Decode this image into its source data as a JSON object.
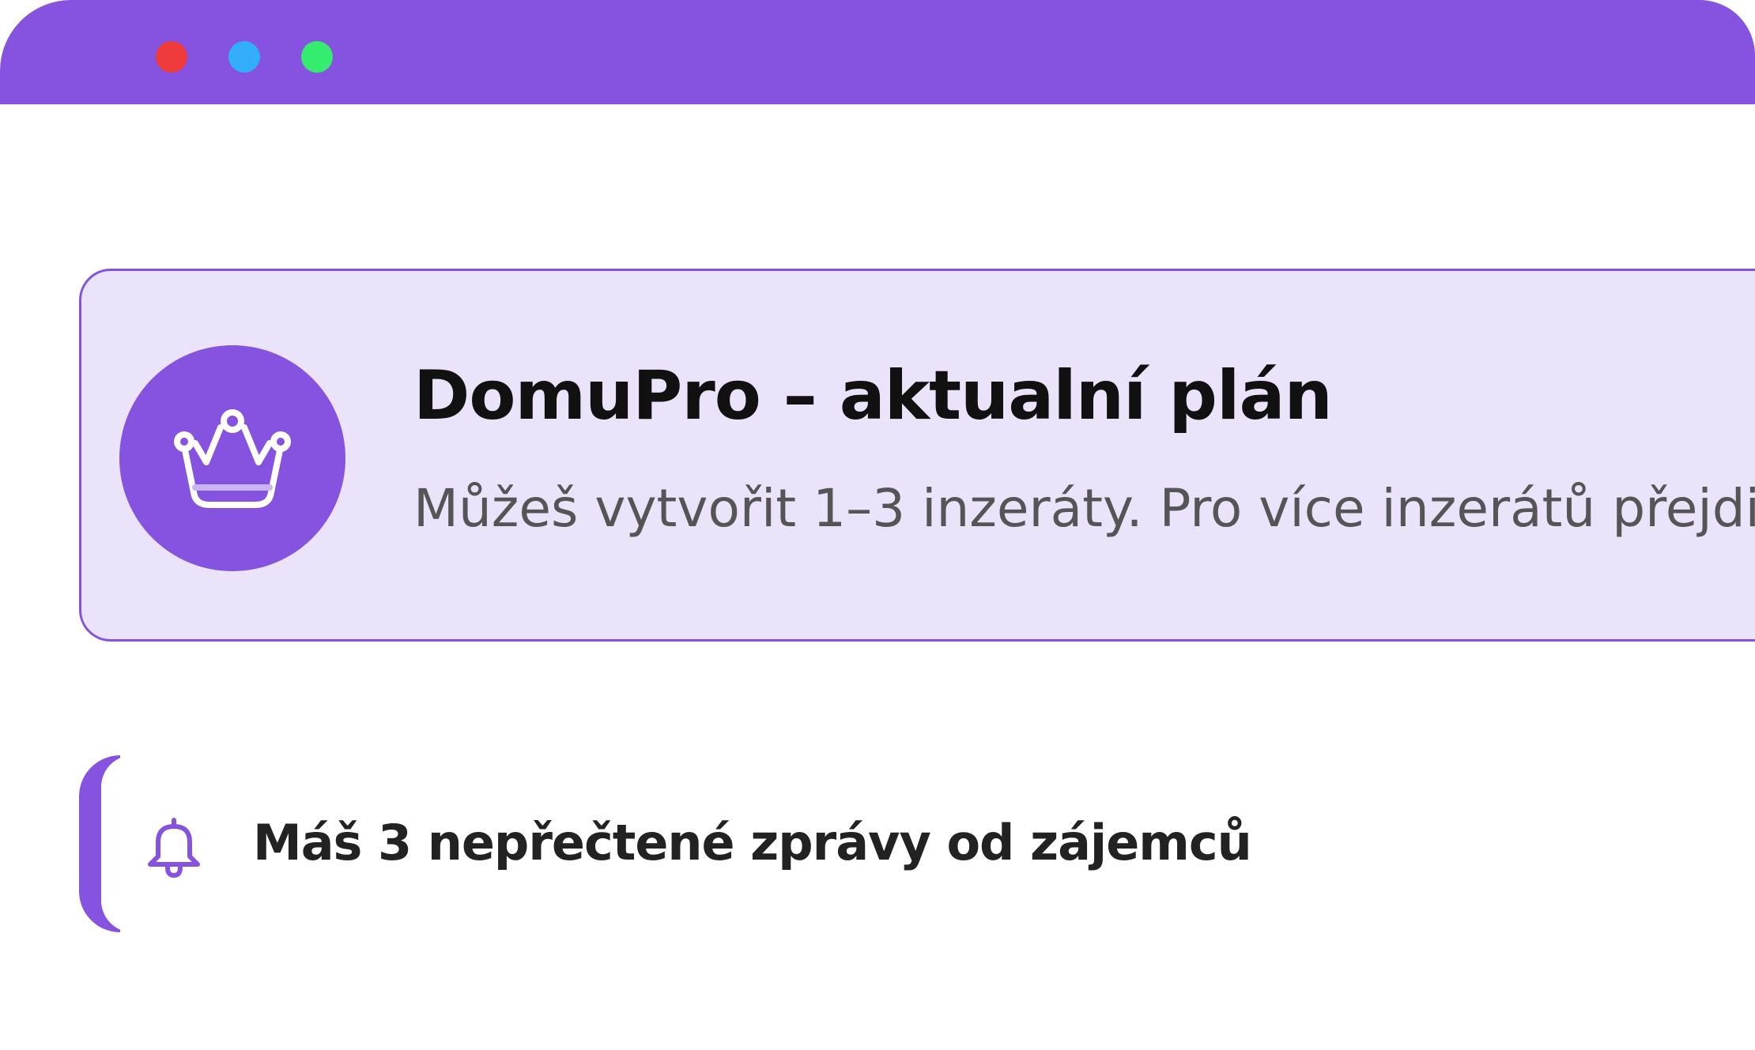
{
  "window": {
    "controls": [
      "close",
      "minimize",
      "maximize"
    ],
    "colors": {
      "titlebar": "#8652E0",
      "close": "#EF3B3B",
      "minimize": "#32ADF8",
      "maximize": "#34ED6E"
    }
  },
  "plan_card": {
    "icon": "crown-icon",
    "title": "DomuPro – aktualní plán",
    "description": "Můžeš vytvořit 1–3 inzeráty. Pro více inzerátů přejdi",
    "background": "#EBE3F9",
    "accent": "#8652E0"
  },
  "notification": {
    "icon": "bell-icon",
    "text": "Máš 3 nepřečtené zprávy od zájemců"
  }
}
